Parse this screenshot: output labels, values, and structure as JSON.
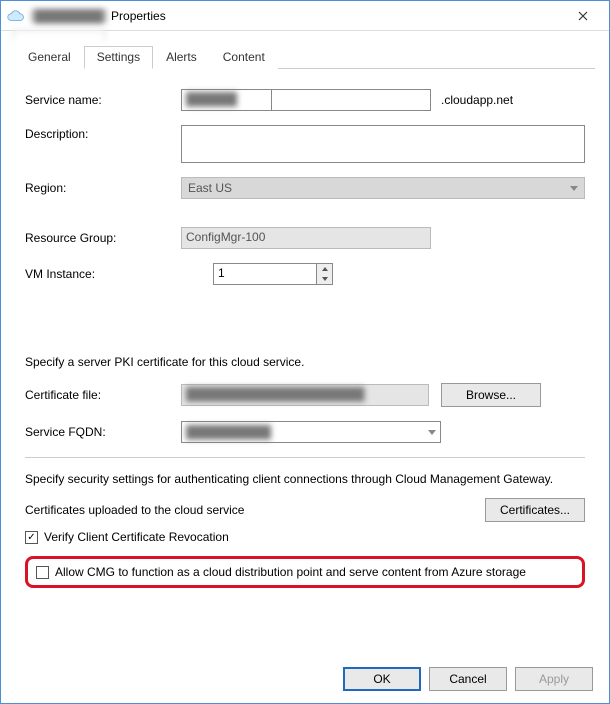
{
  "window": {
    "title": "Properties",
    "redacted_prefix": "████████"
  },
  "tabs": {
    "general": "General",
    "settings": "Settings",
    "alerts": "Alerts",
    "content": "Content",
    "active": "Settings"
  },
  "labels": {
    "service_name": "Service name:",
    "description": "Description:",
    "region": "Region:",
    "resource_group": "Resource Group:",
    "vm_instance": "VM Instance:",
    "cert_section": "Specify a server PKI certificate for this cloud service.",
    "cert_file": "Certificate file:",
    "service_fqdn": "Service FQDN:",
    "sec_section": "Specify security settings for authenticating client connections through Cloud Management Gateway.",
    "certs_uploaded": "Certificates uploaded to the cloud service",
    "verify_crl": "Verify Client Certificate Revocation",
    "allow_cmg": "Allow CMG to function as a cloud distribution point and serve content from Azure storage"
  },
  "values": {
    "service_name": "██████",
    "service_name_suffix": ".cloudapp.net",
    "region": "East US",
    "resource_group": "ConfigMgr-100",
    "vm_instance": "1",
    "cert_file": "█████████████████████",
    "service_fqdn": "██████████",
    "verify_crl_checked": "✓",
    "allow_cmg_checked": ""
  },
  "buttons": {
    "browse": "Browse...",
    "certificates": "Certificates...",
    "ok": "OK",
    "cancel": "Cancel",
    "apply": "Apply"
  }
}
